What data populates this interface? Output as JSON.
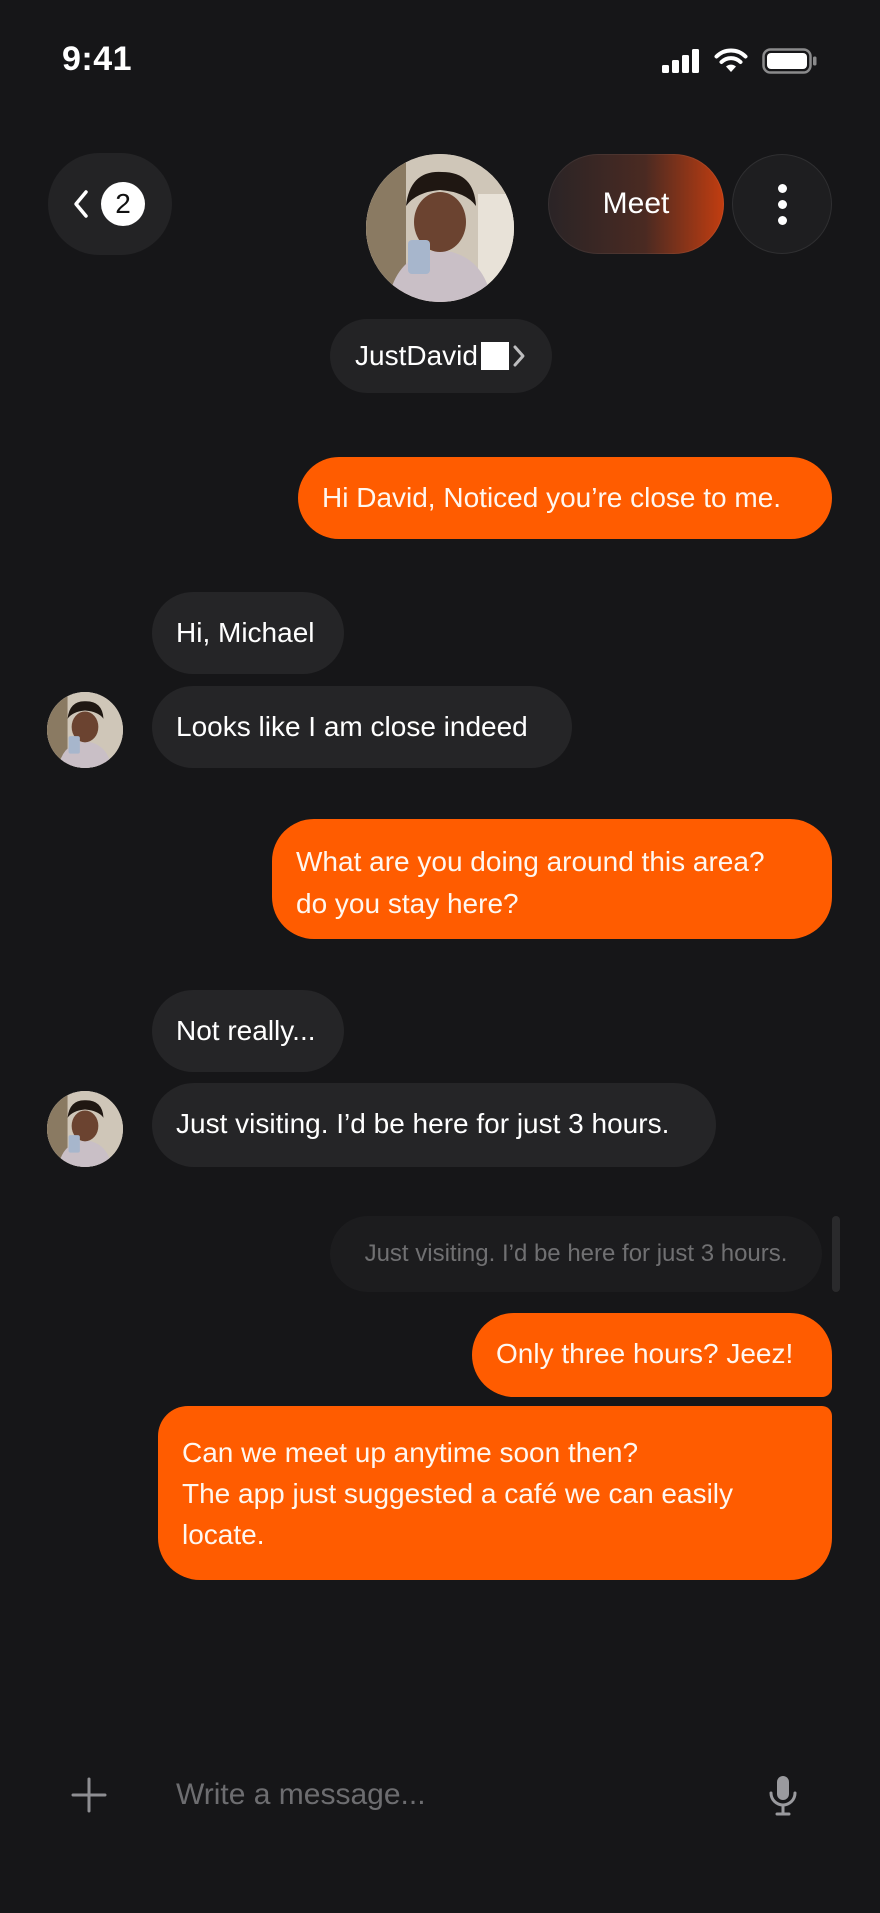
{
  "status_bar": {
    "time": "9:41"
  },
  "header": {
    "back_count": "2",
    "meet_label": "Meet",
    "contact_name": "JustDavid",
    "icons": {
      "back": "chevron-left-icon",
      "more": "more-vertical-icon",
      "chevron": "chevron-right-icon"
    }
  },
  "messages": [
    {
      "side": "out",
      "text": "Hi David, Noticed you’re close to me."
    },
    {
      "side": "in",
      "text": "Hi, Michael"
    },
    {
      "side": "in",
      "text": "Looks like I am close indeed"
    },
    {
      "side": "out",
      "text": "What are you doing around this area?\ndo you stay here?"
    },
    {
      "side": "in",
      "text": "Not really..."
    },
    {
      "side": "in",
      "text": "Just visiting. I’d be here for just 3 hours."
    },
    {
      "side": "out",
      "text": "Only three hours? Jeez!"
    },
    {
      "side": "out",
      "text": "Can we meet up anytime soon then?\nThe app just suggested a café we can easily locate."
    }
  ],
  "reply_preview": "Just visiting. I’d be here for just 3 hours.",
  "composer": {
    "placeholder": "Write a message...",
    "icons": {
      "add": "plus-icon",
      "mic": "microphone-icon"
    }
  },
  "colors": {
    "accent": "#ff5c00",
    "background": "#161618",
    "incoming_bubble": "#252527"
  }
}
